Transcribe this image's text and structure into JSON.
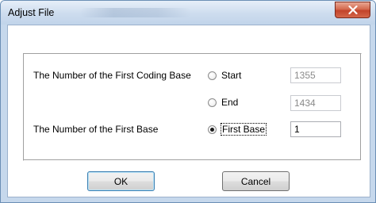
{
  "window": {
    "title": "Adjust File",
    "close_glyph": "✕"
  },
  "group": {
    "first_coding_base_label": "The Number of the First Coding Base",
    "first_base_label": "The Number of the First Base",
    "options": {
      "start": {
        "label": "Start",
        "checked": false,
        "value": "1355",
        "enabled": false
      },
      "end": {
        "label": "End",
        "checked": false,
        "value": "1434",
        "enabled": false
      },
      "first_base": {
        "label": "First Base",
        "checked": true,
        "value": "1",
        "enabled": true
      }
    }
  },
  "buttons": {
    "ok_label": "OK",
    "cancel_label": "Cancel"
  }
}
